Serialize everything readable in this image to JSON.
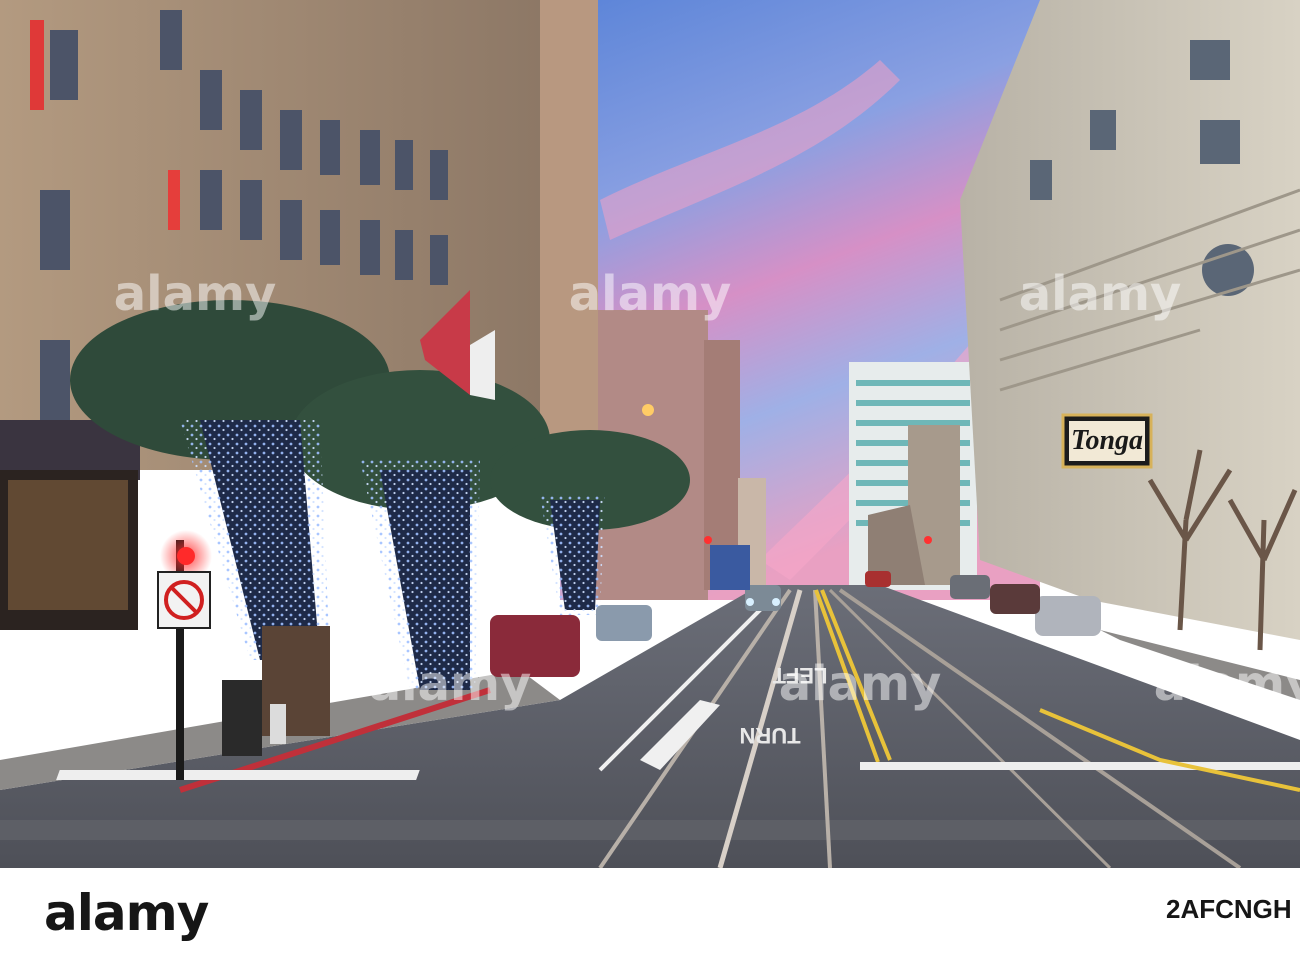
{
  "photo": {
    "sign_text": "Tonga",
    "street_words": [
      "TURN",
      "LEFT"
    ],
    "colors": {
      "sky_top": "#6a8fd6",
      "sky_pink": "#e890b8",
      "tree_lights": "#7ea8ff",
      "traffic_light": "#ff2a2a"
    }
  },
  "watermark": {
    "text": "alamy"
  },
  "footer": {
    "brand": "alamy",
    "image_id": "2AFCNGH"
  }
}
